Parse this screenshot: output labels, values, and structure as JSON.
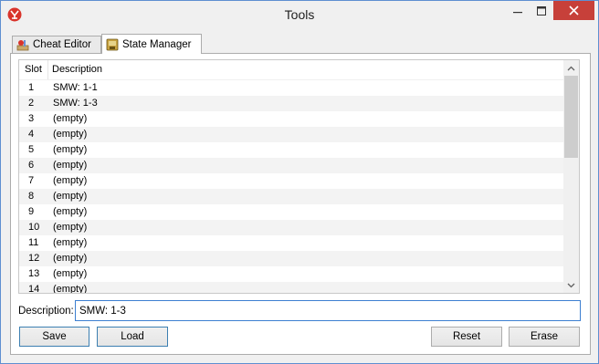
{
  "window": {
    "title": "Tools"
  },
  "tabs": [
    {
      "label": "Cheat Editor",
      "icon": "cheat-editor-icon"
    },
    {
      "label": "State Manager",
      "icon": "state-manager-icon",
      "selected": true
    }
  ],
  "table": {
    "headers": {
      "slot": "Slot",
      "description": "Description"
    },
    "rows": [
      {
        "slot": "1",
        "description": "SMW: 1-1"
      },
      {
        "slot": "2",
        "description": "SMW: 1-3"
      },
      {
        "slot": "3",
        "description": "(empty)"
      },
      {
        "slot": "4",
        "description": "(empty)"
      },
      {
        "slot": "5",
        "description": "(empty)"
      },
      {
        "slot": "6",
        "description": "(empty)"
      },
      {
        "slot": "7",
        "description": "(empty)"
      },
      {
        "slot": "8",
        "description": "(empty)"
      },
      {
        "slot": "9",
        "description": "(empty)"
      },
      {
        "slot": "10",
        "description": "(empty)"
      },
      {
        "slot": "11",
        "description": "(empty)"
      },
      {
        "slot": "12",
        "description": "(empty)"
      },
      {
        "slot": "13",
        "description": "(empty)"
      },
      {
        "slot": "14",
        "description": "(empty)"
      }
    ]
  },
  "description": {
    "label": "Description:",
    "value": "SMW: 1-3"
  },
  "buttons": {
    "save": "Save",
    "load": "Load",
    "reset": "Reset",
    "erase": "Erase"
  },
  "colors": {
    "accent": "#3d7fd1",
    "close": "#c7403a",
    "row_alt": "#f3f3f3"
  }
}
